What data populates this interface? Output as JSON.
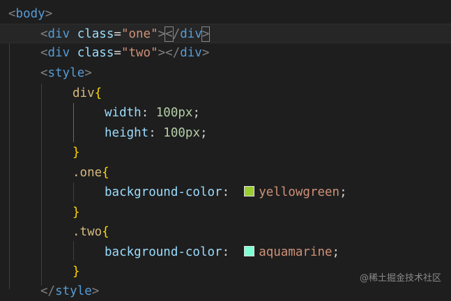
{
  "code": {
    "l1_tag": "body",
    "l2_tag": "div",
    "l2_attr": "class",
    "l2_val": "\"one\"",
    "l2_close": "div",
    "l3_tag": "div",
    "l3_attr": "class",
    "l3_val": "\"two\"",
    "l3_close": "div",
    "l4_tag": "style",
    "l5_sel": "div",
    "l6_prop": "width",
    "l6_val": "100px",
    "l7_prop": "height",
    "l7_val": "100px",
    "l9_sel": ".one",
    "l10_prop": "background-color",
    "l10_val": "yellowgreen",
    "l10_color": "#9acd32",
    "l12_sel": ".two",
    "l13_prop": "background-color",
    "l13_val": "aquamarine",
    "l13_color": "#7fffd4",
    "l15_tag": "style"
  },
  "watermark": "@稀土掘金技术社区"
}
